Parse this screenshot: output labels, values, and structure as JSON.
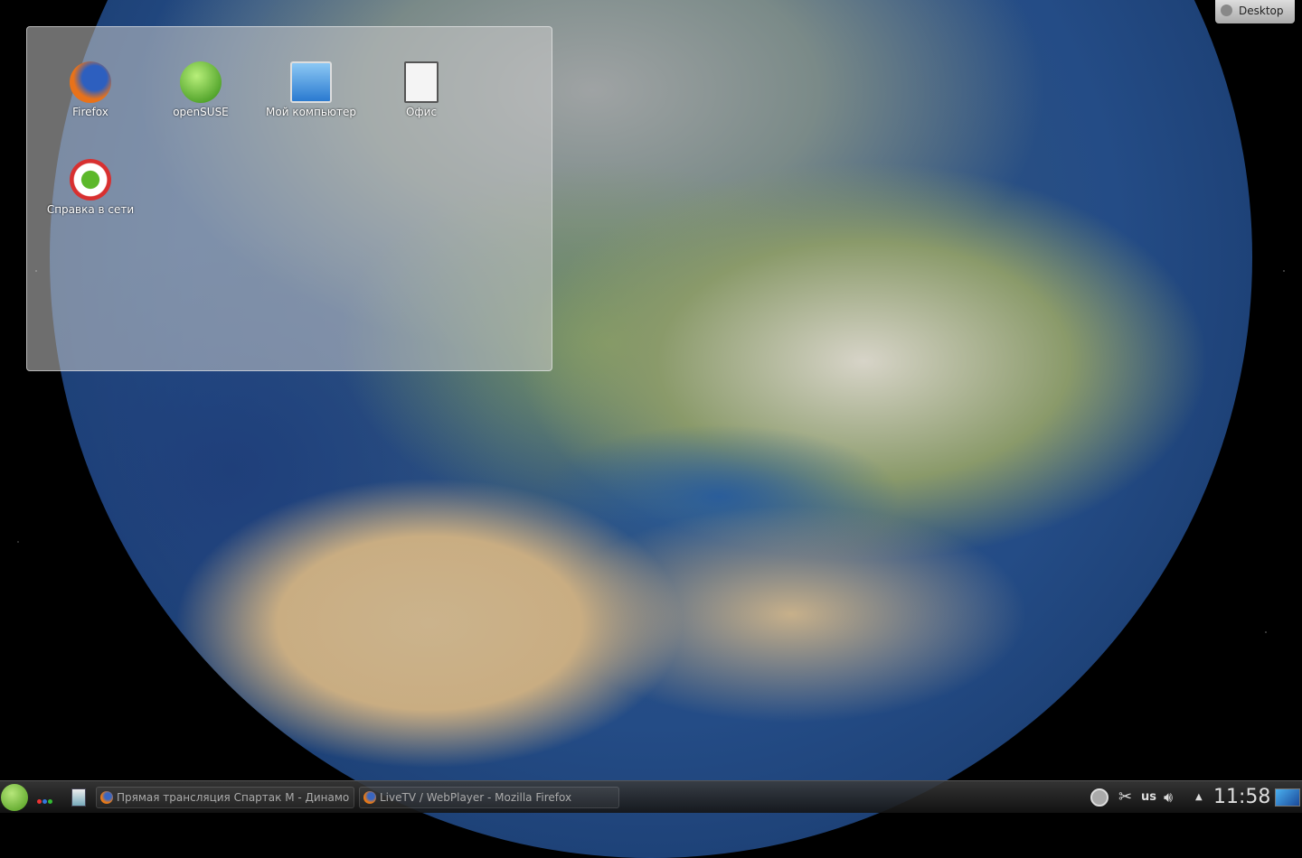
{
  "desktop": {
    "button_label": "Desktop"
  },
  "icons": [
    {
      "label": "Firefox",
      "color": "#e8721a"
    },
    {
      "label": "openSUSE",
      "color": "#4cae1c"
    },
    {
      "label": "Мой компьютер",
      "color": "#3a8fd8"
    },
    {
      "label": "Офис",
      "color": "#f2f2f2"
    },
    {
      "label": "Справка в сети",
      "color": "#d83030"
    }
  ],
  "taskbar": {
    "tasks": [
      {
        "label": "Прямая трансляция Спартак М - Динамо"
      },
      {
        "label": "LiveTV / WebPlayer - Mozilla Firefox"
      }
    ],
    "tray": {
      "keyboard_layout": "us",
      "clock": "11:58"
    }
  }
}
